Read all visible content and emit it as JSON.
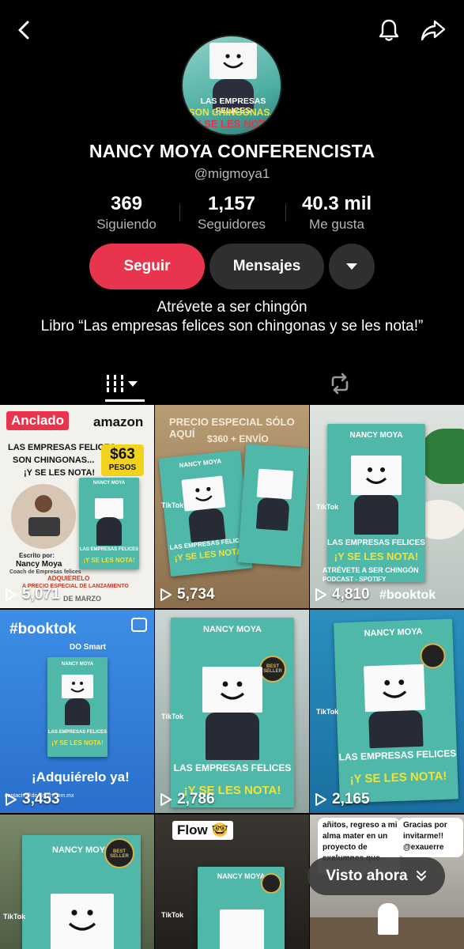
{
  "profile": {
    "name": "NANCY MOYA CONFERENCISTA",
    "handle": "@migmoya1",
    "avatar_text": [
      "LAS EMPRESAS FELICES",
      "SON CHINGONAS...",
      "¡Y SE LES NOTA!"
    ]
  },
  "stats": [
    {
      "num": "369",
      "label": "Siguiendo"
    },
    {
      "num": "1,157",
      "label": "Seguidores"
    },
    {
      "num": "40.3 mil",
      "label": "Me gusta"
    }
  ],
  "actions": {
    "follow": "Seguir",
    "messages": "Mensajes"
  },
  "bio": {
    "line1": "Atrévete a ser chingón",
    "line2": "Libro “Las empresas felices son chingonas y se les nota!”"
  },
  "videos": [
    {
      "views": "5,071",
      "pinned": "Anclado",
      "overlay": [
        "amazon",
        "LAS EMPRESAS FELICES",
        "SON CHINGONAS...",
        "¡Y SE LES NOTA!",
        "$63",
        "PESOS",
        "Escrito por:",
        "Nancy Moya",
        "Coach de Empresas felices",
        "ADQUIERELO",
        "A PRECIO ESPECIAL DE LANZAMIENTO",
        "DE MARZO"
      ]
    },
    {
      "views": "5,734",
      "overlay": [
        "PRECIO ESPECIAL SÓLO AQUÍ",
        "$360 + ENVÍO"
      ]
    },
    {
      "views": "4,810",
      "overlay": [
        "ATRÉVETE A SER CHINGÓN",
        "PODCAST - SPOTIFY",
        "#booktok"
      ]
    },
    {
      "views": "3,453",
      "overlay": [
        "#booktok",
        "DO Smart",
        "¡Adquiérelo ya!",
        "contacto@do-smart.com.mx"
      ]
    },
    {
      "views": "2,786",
      "overlay": []
    },
    {
      "views": "2,165",
      "overlay": []
    },
    {
      "views": "",
      "overlay": []
    },
    {
      "views": "",
      "overlay": [
        "Flow 🤓"
      ]
    },
    {
      "views": "",
      "overlay": [
        "añitos, regreso a mi",
        "alma mater en un",
        "proyecto de",
        "exalumnos que",
        "Gracias por",
        "invitarme!!",
        "@exauerre"
      ]
    }
  ],
  "book": {
    "author": "NANCY MOYA",
    "line1": "LAS EMPRESAS FELICES",
    "line2": "SON CHINGONAS...",
    "line3": "¡Y SE LES NOTA!",
    "badge": "BEST SELLER"
  },
  "tiktok_label": "TikTok",
  "visto": "Visto ahora",
  "colors": {
    "accent": "#e8344c",
    "book": "#4fb8a8",
    "background": "#000000"
  }
}
